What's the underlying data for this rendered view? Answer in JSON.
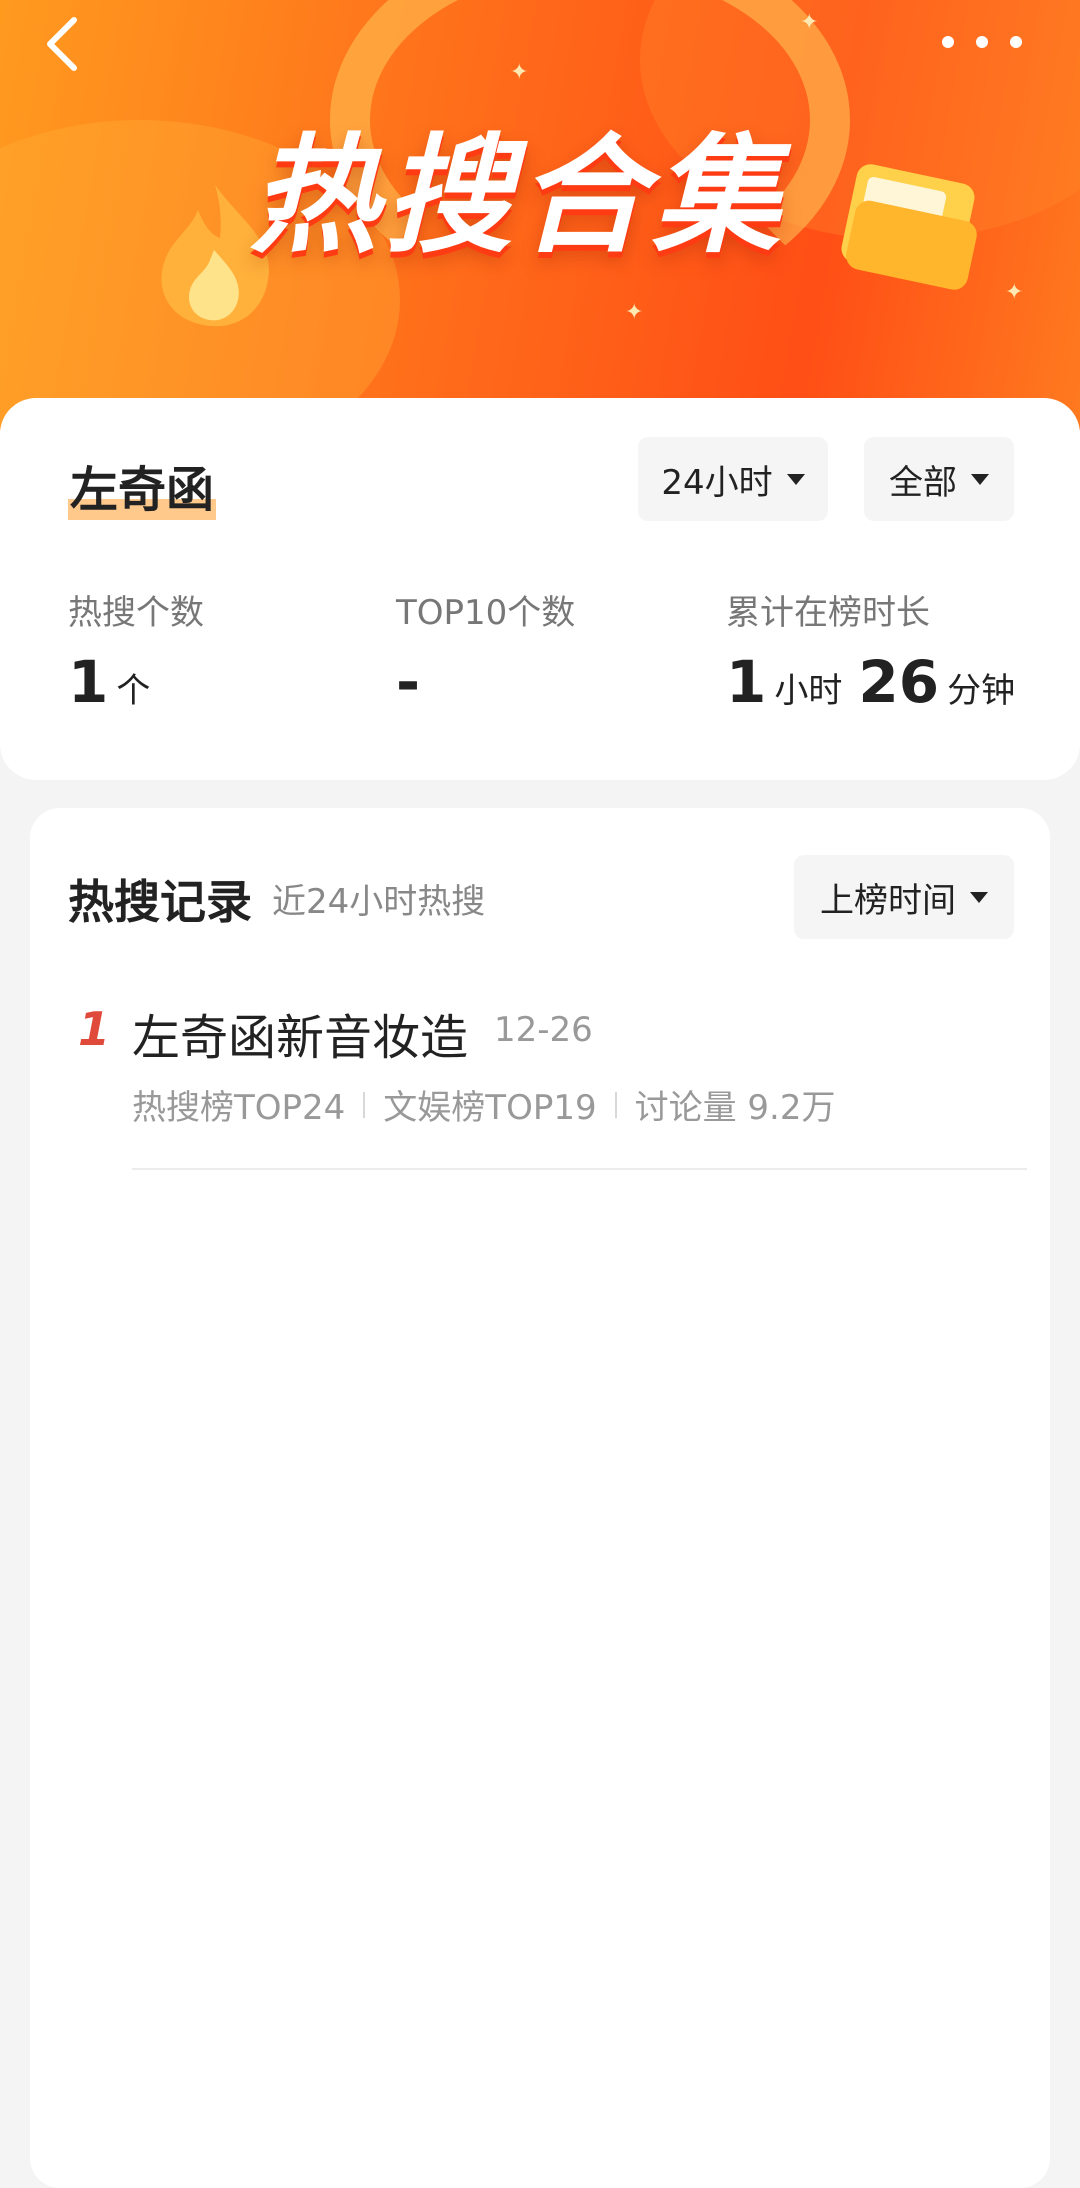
{
  "banner": {
    "title": "热搜合集"
  },
  "profile": {
    "name": "左奇函"
  },
  "filters": {
    "time_range": "24小时",
    "scope": "全部"
  },
  "stats": {
    "hot_count_label": "热搜个数",
    "hot_count_value": "1",
    "hot_count_unit": "个",
    "top10_label": "TOP10个数",
    "top10_value": "-",
    "duration_label": "累计在榜时长",
    "duration_hours": "1",
    "duration_hours_unit": "小时",
    "duration_minutes": "26",
    "duration_minutes_unit": "分钟"
  },
  "records": {
    "title": "热搜记录",
    "subtitle": "近24小时热搜",
    "sort_label": "上榜时间",
    "items": [
      {
        "rank": "1",
        "title": "左奇函新音妆造",
        "date": "12-26",
        "meta": [
          "热搜榜TOP24",
          "文娱榜TOP19",
          "讨论量 9.2万"
        ]
      }
    ]
  },
  "icons": {
    "back": "chevron-left-icon",
    "more": "more-dots-icon",
    "dropdown": "caret-down-icon"
  },
  "colors": {
    "accent": "#ff5a1a",
    "rank": "#e04a3a",
    "name_highlight": "#ffc98c"
  }
}
